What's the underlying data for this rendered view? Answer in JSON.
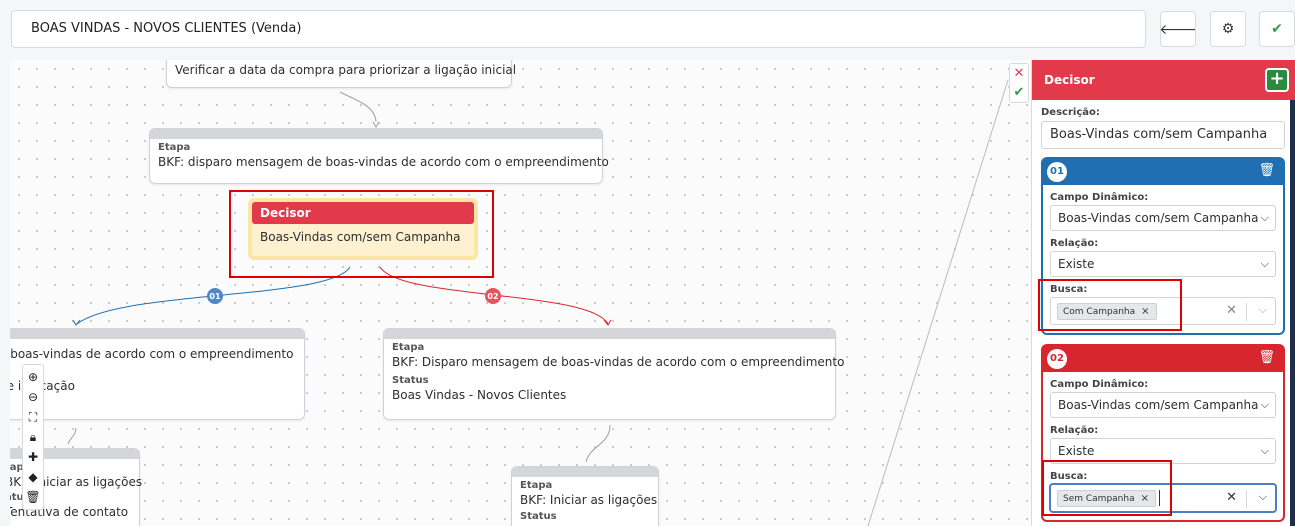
{
  "flow_title": "BOAS VINDAS - NOVOS CLIENTES (Venda)",
  "toolbar": {
    "back_icon": "arrow-left-icon",
    "settings_icon": "gear-icon",
    "confirm_icon": "check-icon"
  },
  "nodes": {
    "top_text": "Verificar a data da compra para priorizar a ligação inicial",
    "etapa_label": "Etapa",
    "status_label": "Status",
    "etapa1_text": "BKF: disparo mensagem de boas-vindas de acordo com o empreendimento",
    "decisor_title": "Decisor",
    "decisor_text": "Boas-Vindas com/sem Campanha",
    "left_text1": "e boas-vindas de acordo com o empreendimento",
    "left_text2": "de indicação",
    "right_text": "BKF: Disparo mensagem de boas-vindas de acordo com o empreendimento",
    "right_status": "Boas Vindas - Novos Clientes",
    "bl_lbl1": "tap",
    "bl_text1": "BKF: Iniciar as ligações",
    "bl_lbl2": "atu",
    "bl_text2": "Tentativa de contato",
    "bc_text": "BKF: Iniciar as ligações",
    "edge1": "01",
    "edge2": "02"
  },
  "panel": {
    "title": "Decisor",
    "desc_label": "Descrição:",
    "desc_value": "Boas-Vindas com/sem Campanha",
    "rules": [
      {
        "num": "01",
        "campo_label": "Campo Dinâmico:",
        "campo_value": "Boas-Vindas com/sem Campanha",
        "relacao_label": "Relação:",
        "relacao_value": "Existe",
        "busca_label": "Busca:",
        "busca_tag": "Com Campanha"
      },
      {
        "num": "02",
        "campo_label": "Campo Dinâmico:",
        "campo_value": "Boas-Vindas com/sem Campanha",
        "relacao_label": "Relação:",
        "relacao_value": "Existe",
        "busca_label": "Busca:",
        "busca_tag": "Sem Campanha"
      }
    ]
  },
  "colors": {
    "red": "#e33a4b",
    "blue": "#1f6fb2",
    "dark_red": "#d7262e",
    "green": "#2a8a3e",
    "highlight": "#e00000"
  }
}
